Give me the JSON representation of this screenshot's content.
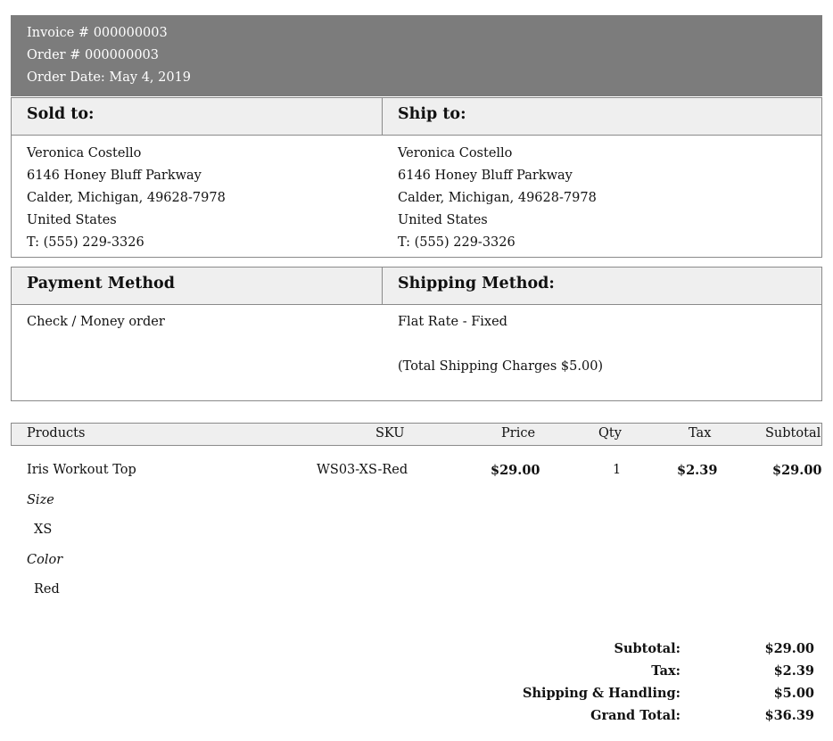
{
  "header": {
    "invoice": "Invoice # 000000003",
    "order": "Order # 000000003",
    "order_date": "Order Date: May 4, 2019"
  },
  "address": {
    "sold_to_label": "Sold to:",
    "ship_to_label": "Ship to:",
    "sold_to": [
      "Veronica Costello",
      "6146 Honey Bluff Parkway",
      "Calder, Michigan, 49628-7978",
      "United States",
      "T: (555) 229-3326"
    ],
    "ship_to": [
      "Veronica Costello",
      "6146 Honey Bluff Parkway",
      "Calder, Michigan, 49628-7978",
      "United States",
      "T: (555) 229-3326"
    ]
  },
  "methods": {
    "payment_label": "Payment Method",
    "shipping_label": "Shipping Method:",
    "payment": "Check / Money order",
    "shipping": "Flat Rate - Fixed",
    "shipping_charges": "(Total Shipping Charges $5.00)"
  },
  "items": {
    "columns": [
      "Products",
      "SKU",
      "Price",
      "Qty",
      "Tax",
      "Subtotal"
    ],
    "rows": [
      {
        "name": "Iris Workout Top",
        "sku": "WS03-XS-Red",
        "price": "$29.00",
        "qty": "1",
        "tax": "$2.39",
        "subtotal": "$29.00",
        "options": [
          {
            "label": "Size",
            "value": "XS"
          },
          {
            "label": "Color",
            "value": "Red"
          }
        ]
      }
    ]
  },
  "totals": [
    {
      "label": "Subtotal:",
      "value": "$29.00"
    },
    {
      "label": "Tax:",
      "value": "$2.39"
    },
    {
      "label": "Shipping & Handling:",
      "value": "$5.00"
    },
    {
      "label": "Grand Total:",
      "value": "$36.39"
    }
  ]
}
